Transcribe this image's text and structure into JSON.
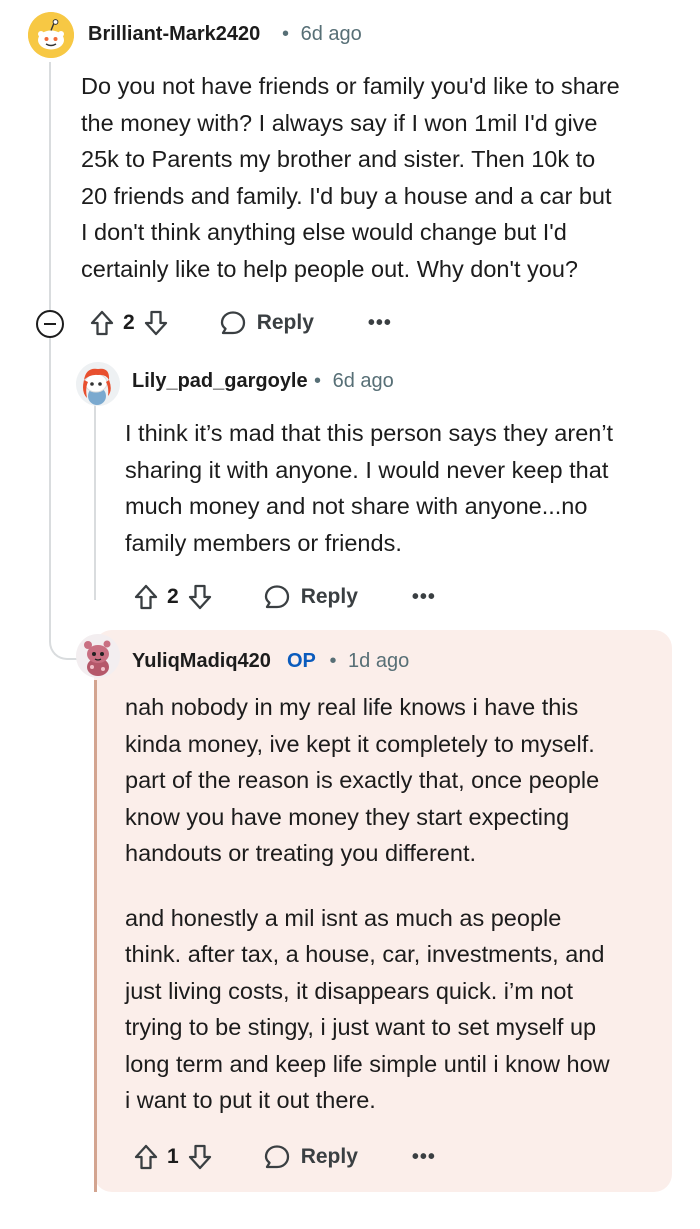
{
  "comments": [
    {
      "username": "Brilliant-Mark2420",
      "separator": "•",
      "time": "6d ago",
      "body": [
        "Do you not have friends or family you'd like to share",
        "the money with? I always say if I won 1mil I'd give",
        "25k to Parents my brother and sister. Then 10k to",
        "20 friends and family. I'd buy a house and a car but",
        "I don't think anything else would change but I'd",
        "certainly like to help people out. Why don't you?"
      ],
      "votes": "2",
      "reply_label": "Reply",
      "more": "•••"
    },
    {
      "username": "Lily_pad_gargoyle",
      "separator": "•",
      "time": "6d ago",
      "body": [
        "I think it’s mad that this person says they aren’t",
        "sharing it with anyone. I would never keep that",
        "much money and not share with anyone...no",
        "family members or friends."
      ],
      "votes": "2",
      "reply_label": "Reply",
      "more": "•••"
    },
    {
      "username": "YuliqMadiq420",
      "badge": "OP",
      "separator": "•",
      "time": "1d ago",
      "body_p1": [
        "nah nobody in my real life knows i have this",
        "kinda money, ive kept it completely to myself.",
        "part of the reason is exactly that, once people",
        "know you have money they start expecting",
        "handouts or treating you different."
      ],
      "body_p2": [
        "and honestly a mil isnt as much as people",
        "think. after tax, a house, car, investments, and",
        "just living costs, it disappears quick. i’m not",
        "trying to be stingy, i just want to set myself up",
        "long term and keep life simple until i know how",
        "i want to put it out there."
      ],
      "votes": "1",
      "reply_label": "Reply",
      "more": "•••"
    }
  ],
  "colors": {
    "op_highlight": "#fbeeea",
    "op_badge": "#0a5bbd",
    "thread_line": "#d9dcde"
  }
}
